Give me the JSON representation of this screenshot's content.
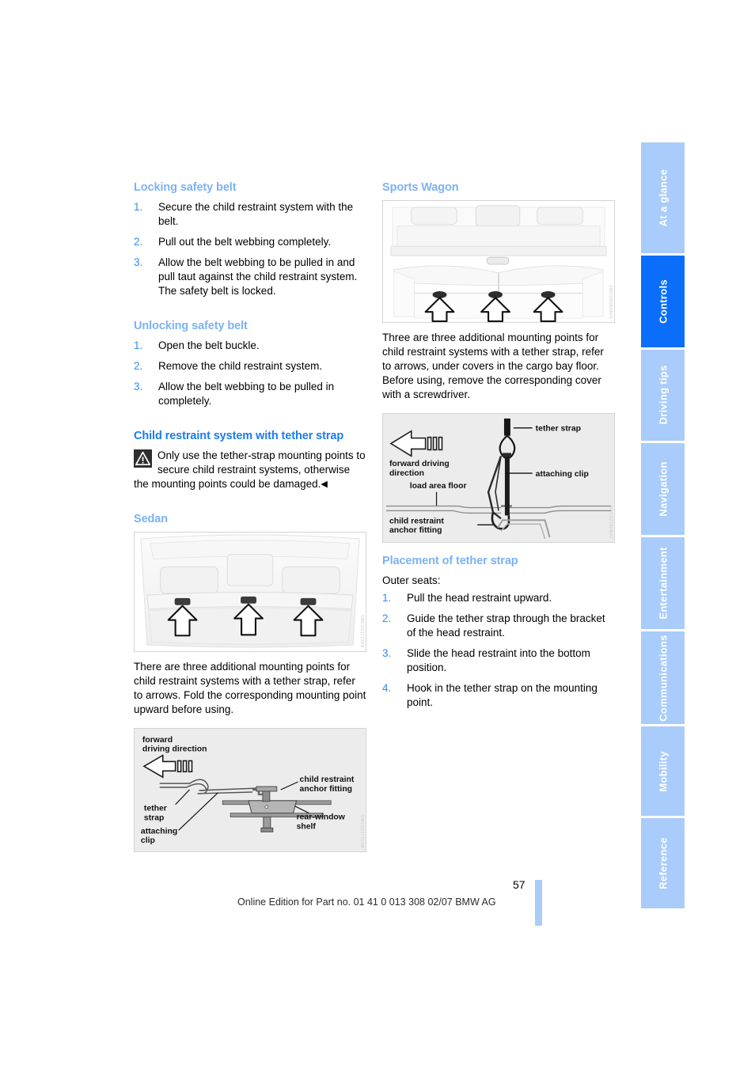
{
  "page": {
    "number": "57",
    "footer_note": "Online Edition for Part no. 01 41 0 013 308 02/07 BMW AG"
  },
  "colors": {
    "heading_primary": "#1a7cf0",
    "heading_secondary": "#7cb2f2",
    "tab_inactive": "#a9ccfa",
    "tab_active": "#0b6efb",
    "list_number": "#2f8cf5",
    "body_text": "#000000"
  },
  "tabs": [
    {
      "label": "At a glance",
      "active": false
    },
    {
      "label": "Controls",
      "active": true
    },
    {
      "label": "Driving tips",
      "active": false
    },
    {
      "label": "Navigation",
      "active": false
    },
    {
      "label": "Entertainment",
      "active": false
    },
    {
      "label": "Communications",
      "active": false
    },
    {
      "label": "Mobility",
      "active": false
    },
    {
      "label": "Reference",
      "active": false
    }
  ],
  "left_column": {
    "locking": {
      "heading": "Locking safety belt",
      "steps": [
        {
          "num": "1.",
          "text": "Secure the child restraint system with the belt."
        },
        {
          "num": "2.",
          "text": "Pull out the belt webbing completely."
        },
        {
          "num": "3.",
          "text": "Allow the belt webbing to be pulled in and pull taut against the child restraint system. The safety belt is locked."
        }
      ]
    },
    "unlocking": {
      "heading": "Unlocking safety belt",
      "steps": [
        {
          "num": "1.",
          "text": "Open the belt buckle."
        },
        {
          "num": "2.",
          "text": "Remove the child restraint system."
        },
        {
          "num": "3.",
          "text": "Allow the belt webbing to be pulled in completely."
        }
      ]
    },
    "tether": {
      "heading": "Child restraint system with tether strap",
      "warning_icon": "warning-triangle-icon",
      "warning_text": "Only use the tether-strap mounting points to secure child restraint systems, otherwise the mounting points could be damaged.",
      "warning_end_marker": "◀"
    },
    "sedan": {
      "heading": "Sedan",
      "figure_name": "sedan-rear-shelf-mounting-points",
      "figure_code": "VWCSU177SHA",
      "caption": "There are three additional mounting points for child restraint systems with a tether strap, refer to arrows. Fold the corresponding mounting point upward before using."
    },
    "sedan_diagram": {
      "figure_name": "sedan-tether-anchor-diagram",
      "figure_code": "VWCSU177GSA",
      "labels": {
        "forward_direction": "forward\ndriving direction",
        "tether_strap": "tether\nstrap",
        "attaching_clip": "attaching\nclip",
        "anchor_fitting": "child restraint\nanchor fitting",
        "shelf": "rear-window\nshelf"
      }
    }
  },
  "right_column": {
    "sports_wagon": {
      "heading": "Sports Wagon",
      "figure_name": "sports-wagon-cargo-mounting-points",
      "figure_code": "VWCSMSB5AVG",
      "caption": "Three are three additional mounting points for child restraint systems with a tether strap, refer to arrows, under covers in the cargo bay floor. Before using, remove the corresponding cover with a screwdriver."
    },
    "wagon_diagram": {
      "figure_name": "wagon-tether-anchor-diagram",
      "figure_code": "VWCSZ1AVMAV",
      "labels": {
        "forward_direction": "forward driving\ndirection",
        "load_area_floor": "load area floor",
        "tether_strap": "tether strap",
        "attaching_clip": "attaching clip",
        "anchor_fitting": "child restraint\nanchor fitting"
      }
    },
    "placement": {
      "heading": "Placement of tether strap",
      "intro": "Outer seats:",
      "steps": [
        {
          "num": "1.",
          "text": "Pull the head restraint upward."
        },
        {
          "num": "2.",
          "text": "Guide the tether strap through the bracket of the head restraint."
        },
        {
          "num": "3.",
          "text": "Slide the head restraint into the bottom position."
        },
        {
          "num": "4.",
          "text": "Hook in the tether strap on the mounting point."
        }
      ]
    }
  }
}
